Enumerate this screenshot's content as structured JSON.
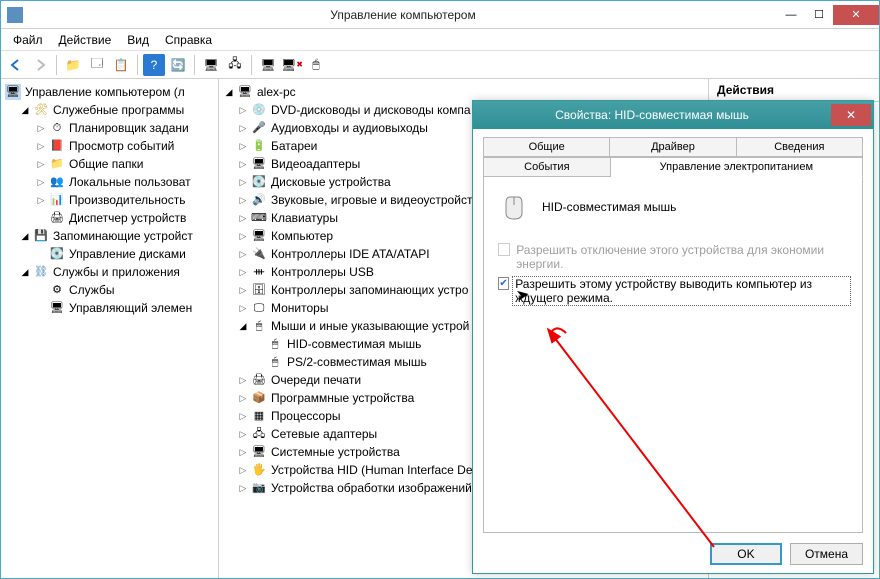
{
  "window": {
    "title": "Управление компьютером",
    "minimize": "—",
    "maximize": "☐",
    "close": "✕"
  },
  "menu": {
    "file": "Файл",
    "action": "Действие",
    "view": "Вид",
    "help": "Справка"
  },
  "right_pane": {
    "header": "Действия"
  },
  "left_tree": {
    "root": "Управление компьютером (л",
    "n1": "Служебные программы",
    "n1a": "Планировщик задани",
    "n1b": "Просмотр событий",
    "n1c": "Общие папки",
    "n1d": "Локальные пользоват",
    "n1e": "Производительность",
    "n1f": "Диспетчер устройств",
    "n2": "Запоминающие устройст",
    "n2a": "Управление дисками",
    "n3": "Службы и приложения",
    "n3a": "Службы",
    "n3b": "Управляющий элемен"
  },
  "mid_tree": {
    "root": "alex-pc",
    "m1": "DVD-дисководы и дисководы компа",
    "m2": "Аудиовходы и аудиовыходы",
    "m3": "Батареи",
    "m4": "Видеоадаптеры",
    "m5": "Дисковые устройства",
    "m6": "Звуковые, игровые и видеоустройст",
    "m7": "Клавиатуры",
    "m8": "Компьютер",
    "m9": "Контроллеры IDE ATA/ATAPI",
    "m10": "Контроллеры USB",
    "m11": "Контроллеры запоминающих устро",
    "m12": "Мониторы",
    "m13": "Мыши и иные указывающие устрой",
    "m13a": "HID-совместимая мышь",
    "m13b": "PS/2-совместимая мышь",
    "m14": "Очереди печати",
    "m15": "Программные устройства",
    "m16": "Процессоры",
    "m17": "Сетевые адаптеры",
    "m18": "Системные устройства",
    "m19": "Устройства HID (Human Interface Dev",
    "m20": "Устройства обработки изображений"
  },
  "dialog": {
    "title": "Свойства: HID-совместимая мышь",
    "tabs": {
      "general": "Общие",
      "driver": "Драйвер",
      "details": "Сведения",
      "events": "События",
      "power": "Управление электропитанием"
    },
    "device_name": "HID-совместимая мышь",
    "chk1": "Разрешить отключение этого устройства для экономии энергии.",
    "chk2": "Разрешить этому устройству выводить компьютер из ждущего режима.",
    "ok": "OK",
    "cancel": "Отмена"
  }
}
